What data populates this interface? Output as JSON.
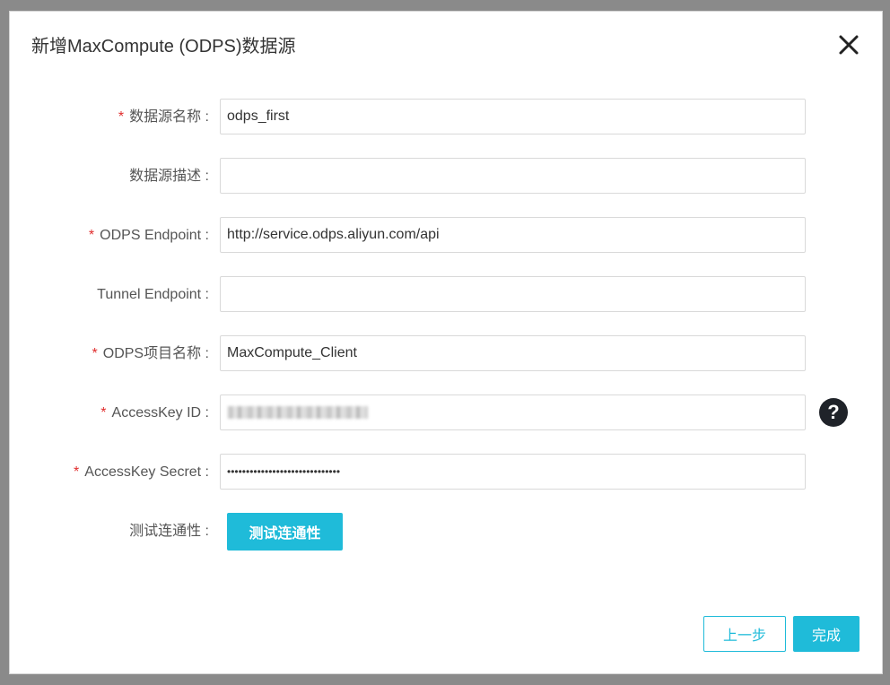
{
  "dialog": {
    "title": "新增MaxCompute (ODPS)数据源"
  },
  "form": {
    "fields": [
      {
        "label": "数据源名称 :",
        "required": true,
        "value": "odps_first"
      },
      {
        "label": "数据源描述 :",
        "required": false,
        "value": ""
      },
      {
        "label": "ODPS Endpoint :",
        "required": true,
        "value": "http://service.odps.aliyun.com/api"
      },
      {
        "label": "Tunnel Endpoint :",
        "required": false,
        "value": ""
      },
      {
        "label": "ODPS项目名称 :",
        "required": true,
        "value": "MaxCompute_Client"
      },
      {
        "label": "AccessKey ID :",
        "required": true,
        "value": ""
      },
      {
        "label": "AccessKey Secret :",
        "required": true,
        "value": "••••••••••••••••••••••••••••••"
      }
    ],
    "required_mark": "*",
    "help_icon": "?",
    "test_label": "测试连通性 :",
    "test_button": "测试连通性"
  },
  "footer": {
    "prev_button": "上一步",
    "done_button": "完成"
  },
  "icons": {
    "close": "close-icon",
    "help": "question-circle-icon"
  },
  "colors": {
    "accent": "#1fbbd9",
    "required": "#e02d2d",
    "help_icon_bg": "#1f2329"
  }
}
